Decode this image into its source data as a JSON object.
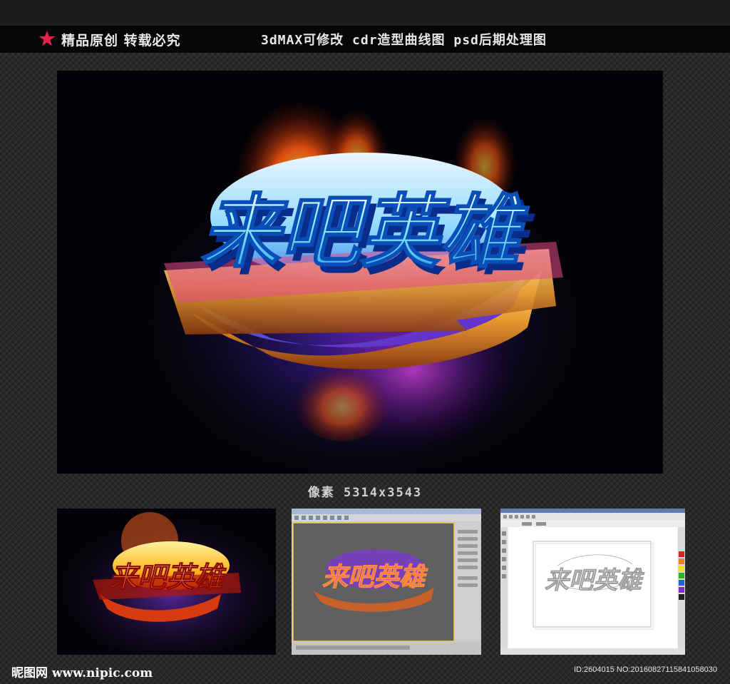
{
  "header": {
    "left_text": "精品原创 转载必究",
    "right_text": "3dMAX可修改  cdr造型曲线图 psd后期处理图",
    "star_color": "#e8224d"
  },
  "main_preview": {
    "logo_text": "来吧英雄"
  },
  "pixel_info": "像素 5314x3543",
  "thumbnails": [
    {
      "kind": "psd-render",
      "logo_text": "来吧英雄"
    },
    {
      "kind": "3dsmax-viewport",
      "logo_text": "来吧英雄"
    },
    {
      "kind": "coreldraw-outline",
      "logo_text": "来吧英雄"
    }
  ],
  "footer": {
    "logo": "昵图网 www.nipic.com",
    "id_text": "ID:2604015 NO:20160827115841058030"
  }
}
